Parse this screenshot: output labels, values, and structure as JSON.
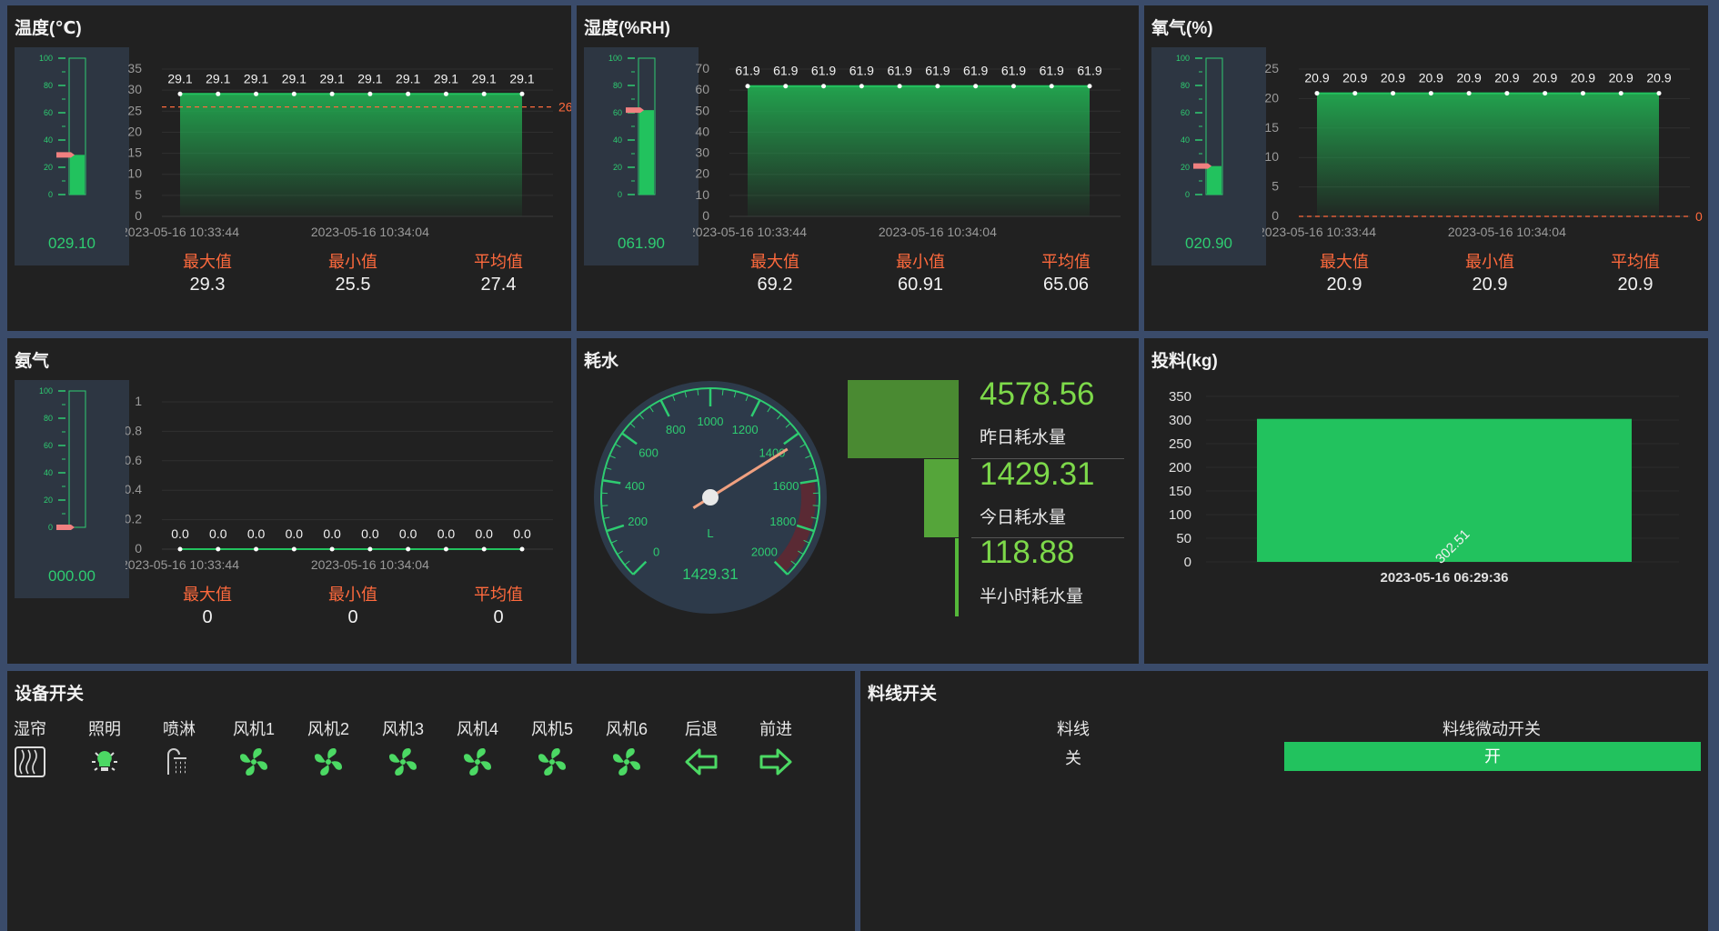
{
  "panels": {
    "temperature": {
      "title": "温度(℃)",
      "gauge_value": "029.10",
      "gauge_level": 29.1,
      "threshold": 26,
      "threshold_label": "26",
      "yticks": [
        "0",
        "5",
        "10",
        "15",
        "20",
        "25",
        "30",
        "35"
      ],
      "ymax": 35,
      "points": [
        29.1,
        29.1,
        29.1,
        29.1,
        29.1,
        29.1,
        29.1,
        29.1,
        29.1,
        29.1
      ],
      "point_labels": [
        "29.1",
        "29.1",
        "29.1",
        "29.1",
        "29.1",
        "29.1",
        "29.1",
        "29.1",
        "29.1",
        "29.1"
      ],
      "xlabels": [
        "2023-05-16 10:33:44",
        "2023-05-16 10:34:04"
      ],
      "stats": [
        {
          "label": "最大值",
          "value": "29.3"
        },
        {
          "label": "最小值",
          "value": "25.5"
        },
        {
          "label": "平均值",
          "value": "27.4"
        }
      ]
    },
    "humidity": {
      "title": "湿度(%RH)",
      "gauge_value": "061.90",
      "gauge_level": 61.9,
      "yticks": [
        "0",
        "10",
        "20",
        "30",
        "40",
        "50",
        "60",
        "70"
      ],
      "ymax": 70,
      "points": [
        61.9,
        61.9,
        61.9,
        61.9,
        61.9,
        61.9,
        61.9,
        61.9,
        61.9,
        61.9
      ],
      "point_labels": [
        "61.9",
        "61.9",
        "61.9",
        "61.9",
        "61.9",
        "61.9",
        "61.9",
        "61.9",
        "61.9",
        "61.9"
      ],
      "xlabels": [
        "2023-05-16 10:33:44",
        "2023-05-16 10:34:04"
      ],
      "stats": [
        {
          "label": "最大值",
          "value": "69.2"
        },
        {
          "label": "最小值",
          "value": "60.91"
        },
        {
          "label": "平均值",
          "value": "65.06"
        }
      ]
    },
    "oxygen": {
      "title": "氧气(%)",
      "gauge_value": "020.90",
      "gauge_level": 20.9,
      "threshold": 0,
      "threshold_label": "0",
      "yticks": [
        "0",
        "5",
        "10",
        "15",
        "20",
        "25"
      ],
      "ymax": 25,
      "points": [
        20.9,
        20.9,
        20.9,
        20.9,
        20.9,
        20.9,
        20.9,
        20.9,
        20.9,
        20.9
      ],
      "point_labels": [
        "20.9",
        "20.9",
        "20.9",
        "20.9",
        "20.9",
        "20.9",
        "20.9",
        "20.9",
        "20.9",
        "20.9"
      ],
      "xlabels": [
        "2023-05-16 10:33:44",
        "2023-05-16 10:34:04"
      ],
      "stats": [
        {
          "label": "最大值",
          "value": "20.9"
        },
        {
          "label": "最小值",
          "value": "20.9"
        },
        {
          "label": "平均值",
          "value": "20.9"
        }
      ]
    },
    "ammonia": {
      "title": "氨气",
      "gauge_value": "000.00",
      "gauge_level": 0,
      "yticks": [
        "0",
        "0.2",
        "0.4",
        "0.6",
        "0.8",
        "1"
      ],
      "ymax": 1,
      "points": [
        0,
        0,
        0,
        0,
        0,
        0,
        0,
        0,
        0,
        0
      ],
      "point_labels": [
        "0.0",
        "0.0",
        "0.0",
        "0.0",
        "0.0",
        "0.0",
        "0.0",
        "0.0",
        "0.0",
        "0.0"
      ],
      "xlabels": [
        "2023-05-16 10:33:44",
        "2023-05-16 10:34:04"
      ],
      "stats": [
        {
          "label": "最大值",
          "value": "0"
        },
        {
          "label": "最小值",
          "value": "0"
        },
        {
          "label": "平均值",
          "value": "0"
        }
      ]
    },
    "water": {
      "title": "耗水",
      "dial_ticks": [
        "0",
        "200",
        "400",
        "600",
        "800",
        "1000",
        "1200",
        "1400",
        "1600",
        "1800",
        "2000"
      ],
      "dial_unit": "L",
      "dial_value": "1429.31",
      "dial_level": 1429.31,
      "dial_max": 2000,
      "items": [
        {
          "value": "4578.56",
          "label": "昨日耗水量"
        },
        {
          "value": "1429.31",
          "label": "今日耗水量"
        },
        {
          "value": "118.88",
          "label": "半小时耗水量"
        }
      ]
    },
    "feed": {
      "title": "投料(kg)",
      "yticks": [
        "0",
        "50",
        "100",
        "150",
        "200",
        "250",
        "300",
        "350"
      ],
      "ymax": 350,
      "category": "2023-05-16 06:29:36",
      "value": 302.51,
      "value_label": "302.51"
    }
  },
  "devices": {
    "title": "设备开关",
    "items": [
      {
        "label": "湿帘",
        "icon": "curtain-icon"
      },
      {
        "label": "照明",
        "icon": "bulb-icon"
      },
      {
        "label": "喷淋",
        "icon": "shower-icon"
      },
      {
        "label": "风机1",
        "icon": "fan-icon"
      },
      {
        "label": "风机2",
        "icon": "fan-icon"
      },
      {
        "label": "风机3",
        "icon": "fan-icon"
      },
      {
        "label": "风机4",
        "icon": "fan-icon"
      },
      {
        "label": "风机5",
        "icon": "fan-icon"
      },
      {
        "label": "风机6",
        "icon": "fan-icon"
      },
      {
        "label": "后退",
        "icon": "arrow-left-icon"
      },
      {
        "label": "前进",
        "icon": "arrow-right-icon"
      }
    ]
  },
  "feedline": {
    "title": "料线开关",
    "col1_header": "料线",
    "col1_value": "关",
    "col2_header": "料线微动开关",
    "col2_value": "开"
  },
  "colors": {
    "accent_green": "#22c25e",
    "alert_orange": "#ff6a3d",
    "water_green": "#7dd94a"
  }
}
